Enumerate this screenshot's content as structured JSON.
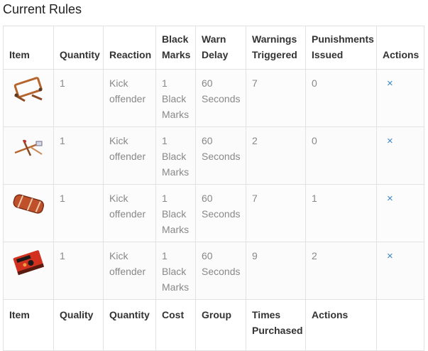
{
  "title": "Current Rules",
  "columns": [
    "Item",
    "Quantity",
    "Reaction",
    "Black Marks",
    "Warn Delay",
    "Warnings Triggered",
    "Punishments Issued",
    "Actions"
  ],
  "rows": [
    {
      "item_icon": "metal-frame-icon",
      "quantity": "1",
      "reaction": "Kick offender",
      "black_marks": "1 Black Marks",
      "warn_delay": "60 Seconds",
      "warnings": "7",
      "punishments": "0",
      "action": "×"
    },
    {
      "item_icon": "slingshot-frame-icon",
      "quantity": "1",
      "reaction": "Kick offender",
      "black_marks": "1 Black Marks",
      "warn_delay": "60 Seconds",
      "warnings": "2",
      "punishments": "0",
      "action": "×"
    },
    {
      "item_icon": "wrapped-bundle-icon",
      "quantity": "1",
      "reaction": "Kick offender",
      "black_marks": "1 Black Marks",
      "warn_delay": "60 Seconds",
      "warnings": "7",
      "punishments": "1",
      "action": "×"
    },
    {
      "item_icon": "red-book-icon",
      "quantity": "1",
      "reaction": "Kick offender",
      "black_marks": "1 Black Marks",
      "warn_delay": "60 Seconds",
      "warnings": "9",
      "punishments": "2",
      "action": "×"
    }
  ],
  "footer_columns": [
    "Item",
    "Quality",
    "Quantity",
    "Cost",
    "Group",
    "Times Purchased",
    "Actions",
    ""
  ]
}
